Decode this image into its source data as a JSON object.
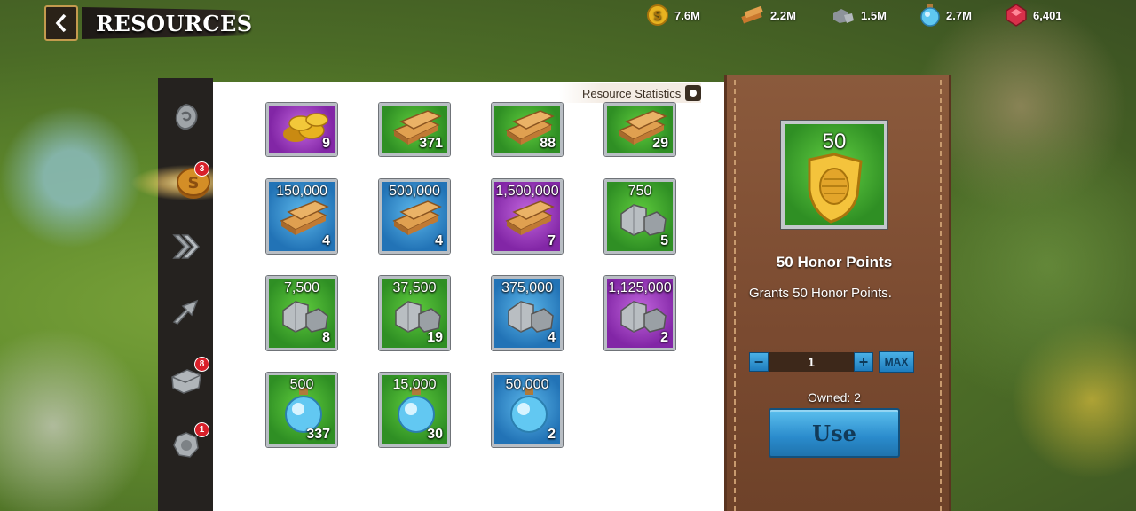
{
  "header": {
    "title": "RESOURCES",
    "back_icon": "chevron-left-icon"
  },
  "resources": [
    {
      "icon": "gold-coin-icon",
      "value": "7.6M",
      "color": "#e6b422"
    },
    {
      "icon": "wood-icon",
      "value": "2.2M",
      "color": "#d08a3a"
    },
    {
      "icon": "stone-icon",
      "value": "1.5M",
      "color": "#9aa0a6"
    },
    {
      "icon": "mana-potion-icon",
      "value": "2.7M",
      "color": "#5fc8f0"
    },
    {
      "icon": "gem-icon",
      "value": "6,401",
      "color": "#d8304a"
    }
  ],
  "tabs": [
    {
      "icon": "shield-swirl-icon",
      "badge": ""
    },
    {
      "icon": "coin-icon",
      "badge": "3",
      "active": true
    },
    {
      "icon": "double-arrow-icon",
      "badge": ""
    },
    {
      "icon": "boot-arrow-icon",
      "badge": ""
    },
    {
      "icon": "chest-icon",
      "badge": "8"
    },
    {
      "icon": "gear-shield-icon",
      "badge": "1"
    }
  ],
  "stats_link": {
    "label": "Resource Statistics",
    "icon": "magnifier-icon"
  },
  "items": [
    {
      "type": "gold",
      "rarity": "purple",
      "amount": "",
      "count": "9"
    },
    {
      "type": "wood",
      "rarity": "green",
      "amount": "",
      "count": "371"
    },
    {
      "type": "wood",
      "rarity": "green",
      "amount": "",
      "count": "88"
    },
    {
      "type": "wood",
      "rarity": "green",
      "amount": "",
      "count": "29"
    },
    {
      "type": "wood",
      "rarity": "blue",
      "amount": "150,000",
      "count": "4"
    },
    {
      "type": "wood",
      "rarity": "blue",
      "amount": "500,000",
      "count": "4"
    },
    {
      "type": "wood",
      "rarity": "purple",
      "amount": "1,500,000",
      "count": "7"
    },
    {
      "type": "stone",
      "rarity": "green",
      "amount": "750",
      "count": "5"
    },
    {
      "type": "stone",
      "rarity": "green",
      "amount": "7,500",
      "count": "8"
    },
    {
      "type": "stone",
      "rarity": "green",
      "amount": "37,500",
      "count": "19"
    },
    {
      "type": "stone",
      "rarity": "blue",
      "amount": "375,000",
      "count": "4"
    },
    {
      "type": "stone",
      "rarity": "purple",
      "amount": "1,125,000",
      "count": "2"
    },
    {
      "type": "potion",
      "rarity": "green",
      "amount": "500",
      "count": "337"
    },
    {
      "type": "potion",
      "rarity": "green",
      "amount": "15,000",
      "count": "30"
    },
    {
      "type": "potion",
      "rarity": "blue",
      "amount": "50,000",
      "count": "2"
    }
  ],
  "detail": {
    "amount": "50",
    "icon": "honor-shield-icon",
    "name": "50 Honor Points",
    "description": "Grants 50 Honor Points.",
    "quantity": "1",
    "minus": "−",
    "plus": "+",
    "max_label": "MAX",
    "owned": "Owned: 2",
    "use_label": "Use"
  }
}
